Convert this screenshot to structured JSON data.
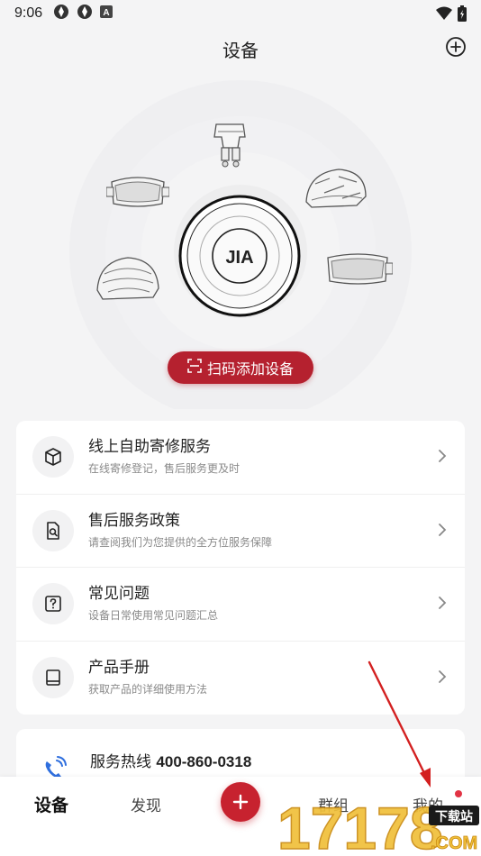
{
  "status_bar": {
    "time": "9:06",
    "icons": [
      "app-notification-icon",
      "app-notification-icon",
      "a-letter-icon",
      "wifi-icon",
      "battery-icon"
    ]
  },
  "header": {
    "title": "设备",
    "add_icon": "plus-circle-icon"
  },
  "hero": {
    "center_logo": "JIA",
    "gear_icons": [
      "camera-mount-icon",
      "ski-goggles-icon",
      "bike-helmet-icon",
      "goggles-icon",
      "helmet-icon"
    ],
    "scan_button": "扫码添加设备",
    "scan_icon": "scan-icon"
  },
  "services": [
    {
      "title": "线上自助寄修服务",
      "subtitle": "在线寄修登记，售后服务更及时",
      "icon": "package-icon"
    },
    {
      "title": "售后服务政策",
      "subtitle": "请查阅我们为您提供的全方位服务保障",
      "icon": "doc-search-icon"
    },
    {
      "title": "常见问题",
      "subtitle": "设备日常使用常见问题汇总",
      "icon": "question-icon"
    },
    {
      "title": "产品手册",
      "subtitle": "获取产品的详细使用方法",
      "icon": "book-icon"
    }
  ],
  "hotline": {
    "label": "服务热线",
    "number": "400-860-0318",
    "icon": "phone-icon"
  },
  "bottom_nav": {
    "items": [
      "设备",
      "发现",
      "群组",
      "我的"
    ],
    "active": "设备",
    "fab_icon": "plus-icon"
  },
  "watermark": {
    "text": "17178",
    "badge": "下载站",
    "domain": ".COM"
  },
  "colors": {
    "accent": "#b5212f",
    "background": "#f4f4f5",
    "card": "#ffffff",
    "subtitle": "#8a8a8a"
  }
}
